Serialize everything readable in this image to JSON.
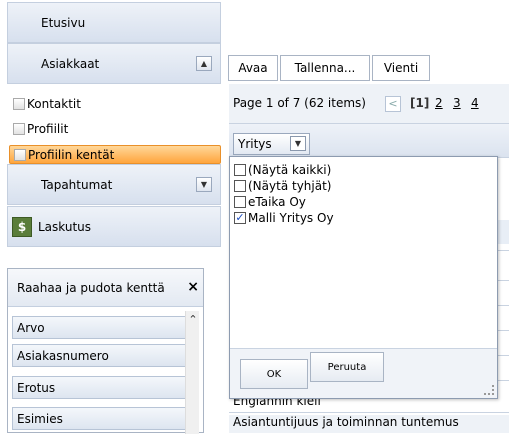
{
  "nav": {
    "home": "Etusivu",
    "customers": "Asiakkaat",
    "customers_toggle": "▲",
    "sub": [
      {
        "label": "Kontaktit"
      },
      {
        "label": "Profiilit"
      },
      {
        "label": "Profiilin kentät",
        "selected": true
      }
    ],
    "events": "Tapahtumat",
    "events_toggle": "▼",
    "billing": "Laskutus"
  },
  "toolbar": {
    "open": "Avaa",
    "save": "Tallenna...",
    "export": "Vienti"
  },
  "pager": {
    "info": "Page 1 of 7 (62 items)",
    "prev": "<",
    "current": "[1]",
    "pages": [
      "2",
      "3",
      "4"
    ]
  },
  "column": {
    "header": "Yritys",
    "filter_icon": "▼"
  },
  "filter": {
    "options": [
      {
        "label": "(Näytä kaikki)",
        "checked": false
      },
      {
        "label": "(Näytä tyhjät)",
        "checked": false
      },
      {
        "label": "eTaika Oy",
        "checked": false
      },
      {
        "label": "Malli Yritys Oy",
        "checked": true
      }
    ],
    "ok": "OK",
    "cancel": "Peruuta"
  },
  "grid_rows": [
    "Englannin kieli",
    "Asiantuntijuus ja toiminnan tuntemus"
  ],
  "field_list": {
    "title": "Raahaa ja pudota kenttä",
    "close": "×",
    "items": [
      "Arvo",
      "Asiakasnumero",
      "Erotus",
      "Esimies"
    ]
  }
}
